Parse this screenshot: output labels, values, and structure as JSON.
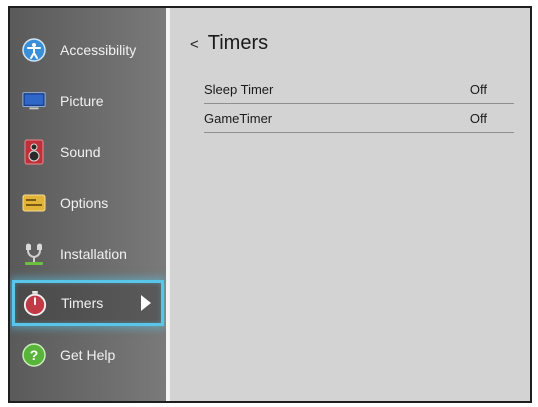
{
  "sidebar": {
    "items": [
      {
        "label": "Accessibility",
        "icon": "accessibility-icon"
      },
      {
        "label": "Picture",
        "icon": "monitor-icon"
      },
      {
        "label": "Sound",
        "icon": "speaker-icon"
      },
      {
        "label": "Options",
        "icon": "options-icon"
      },
      {
        "label": "Installation",
        "icon": "installation-icon"
      },
      {
        "label": "Timers",
        "icon": "stopwatch-icon",
        "selected": true
      },
      {
        "label": "Get Help",
        "icon": "help-icon"
      }
    ]
  },
  "main": {
    "back_glyph": "<",
    "title": "Timers",
    "rows": [
      {
        "label": "Sleep Timer",
        "value": "Off"
      },
      {
        "label": "GameTimer",
        "value": "Off"
      }
    ]
  },
  "colors": {
    "selection_border": "#57c6e8",
    "sidebar_bg": "#6a6a6a",
    "content_bg": "#d3d3d3"
  }
}
